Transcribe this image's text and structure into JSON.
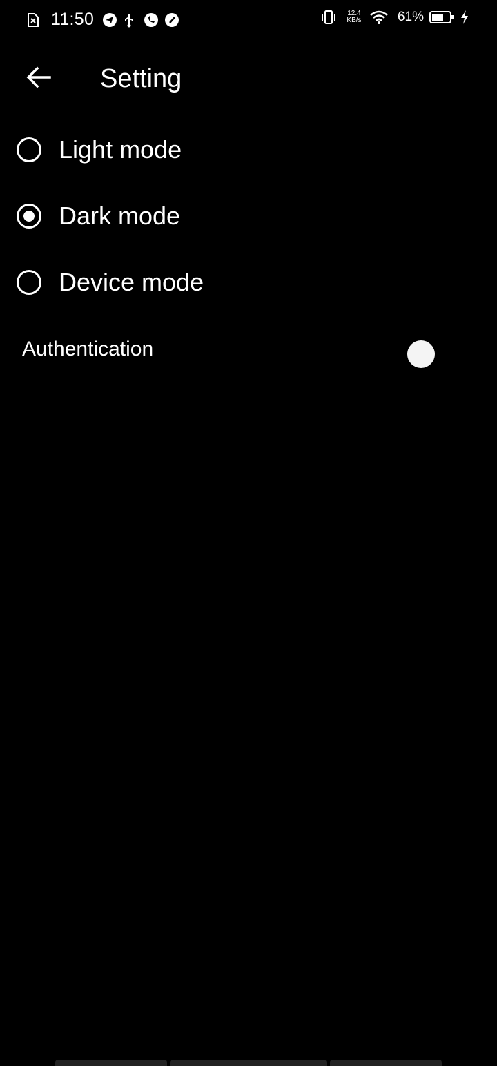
{
  "status_bar": {
    "time": "11:50",
    "left_icons": [
      "sim-error-icon",
      "telegram-icon",
      "usb-icon",
      "whatsapp-icon",
      "speedometer-icon"
    ],
    "net_speed_value": "12.4",
    "net_speed_unit": "KB/s",
    "battery_percent": "61%",
    "right_icons": [
      "vibrate-icon",
      "wifi-icon",
      "battery-icon",
      "charging-icon"
    ]
  },
  "app_bar": {
    "back_icon": "back-arrow-icon",
    "title": "Setting"
  },
  "theme_options": [
    {
      "label": "Light mode",
      "selected": false
    },
    {
      "label": "Dark mode",
      "selected": true
    },
    {
      "label": "Device mode",
      "selected": false
    }
  ],
  "authentication": {
    "label": "Authentication",
    "enabled": false
  },
  "colors": {
    "background": "#000000",
    "foreground": "#ffffff",
    "toggle_thumb": "#f4f4f4"
  }
}
